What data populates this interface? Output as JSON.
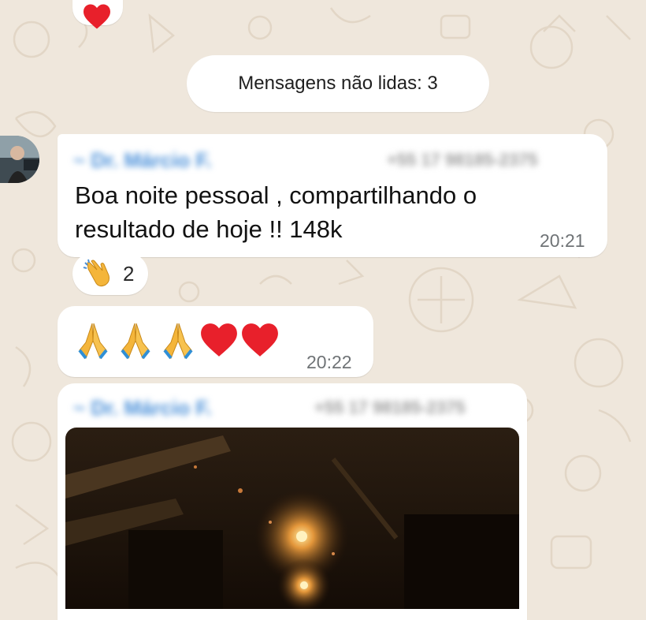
{
  "chat": {
    "unread_banner": "Mensagens não lidas: 3",
    "messages": [
      {
        "sender_name": "~ Dr. Márcio F.",
        "sender_phone": "+55 17 98185-2375",
        "text_line1": "Boa noite pessoal , compartilhando o",
        "text_line2": "resultado de hoje !! 148k",
        "time": "20:21",
        "reaction": {
          "emoji": "clapping-hands",
          "count": "2"
        }
      },
      {
        "emojis": [
          "folded-hands",
          "folded-hands",
          "folded-hands",
          "red-heart",
          "red-heart"
        ],
        "time": "20:22"
      },
      {
        "sender_name": "~ Dr. Márcio F.",
        "sender_phone": "+55 17 98185-2375",
        "media": "photo"
      }
    ]
  },
  "colors": {
    "wallpaper": "#efe7dc",
    "bubble": "#ffffff",
    "blurred_name": "#4a90d9",
    "blurred_phone": "#9a9a9a",
    "timestamp": "#6f7376",
    "heart": "#e8202b",
    "hands": "#f4b53a"
  }
}
